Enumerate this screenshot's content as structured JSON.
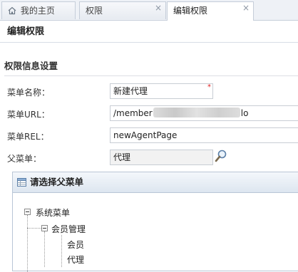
{
  "tabs": [
    {
      "label": "我的主页",
      "icon": "home-icon"
    },
    {
      "label": "权限",
      "closable": true
    },
    {
      "label": "编辑权限",
      "closable": true,
      "active": true
    }
  ],
  "close_glyph": "×",
  "page_title": "编辑权限",
  "section_title": "权限信息设置",
  "form": {
    "menu_name": {
      "label": "菜单名称：",
      "value": "新建代理",
      "required_mark": "*"
    },
    "menu_url": {
      "label": "菜单URL：",
      "value_prefix": "/member",
      "value_suffix": "lo"
    },
    "menu_rel": {
      "label": "菜单REL：",
      "value": "newAgentPage"
    },
    "parent_menu": {
      "label": "父菜单：",
      "value": "代理",
      "lookup_icon": "magnifier-icon"
    }
  },
  "panel": {
    "title": "请选择父菜单",
    "icon": "table-icon",
    "tree": {
      "root": "系统菜单",
      "child": "会员管理",
      "leaves": [
        "会员",
        "代理"
      ]
    }
  }
}
